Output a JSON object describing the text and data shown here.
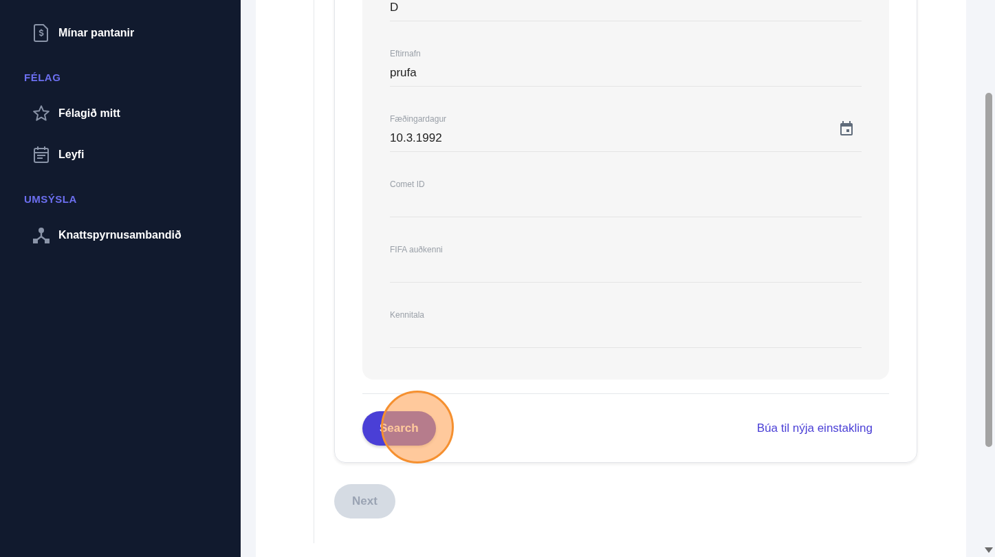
{
  "sidebar": {
    "entries": [
      {
        "kind": "link",
        "label": "Mínar pantanir"
      },
      {
        "kind": "heading",
        "label": "FÉLAG"
      },
      {
        "kind": "link",
        "label": "Félagið mitt"
      },
      {
        "kind": "link",
        "label": "Leyfi"
      },
      {
        "kind": "heading",
        "label": "UMSÝSLA"
      },
      {
        "kind": "link",
        "label": "Knattspyrnusambandið"
      }
    ]
  },
  "form": {
    "fields": [
      {
        "kind": "text",
        "value": "D"
      },
      {
        "kind": "text",
        "label": "Eftirnafn",
        "value": "prufa"
      },
      {
        "kind": "date",
        "label": "Fæðingardagur",
        "value": "10.3.1992"
      },
      {
        "kind": "text",
        "label": "Comet ID"
      },
      {
        "kind": "text",
        "label": "FIFA auðkenni"
      },
      {
        "kind": "text",
        "label": "Kennitala"
      }
    ],
    "search_button": {
      "label": "Search"
    },
    "create_link": {
      "label": "Búa til nýja einstakling"
    }
  },
  "next_button": {
    "label": "Next",
    "disabled": true
  }
}
